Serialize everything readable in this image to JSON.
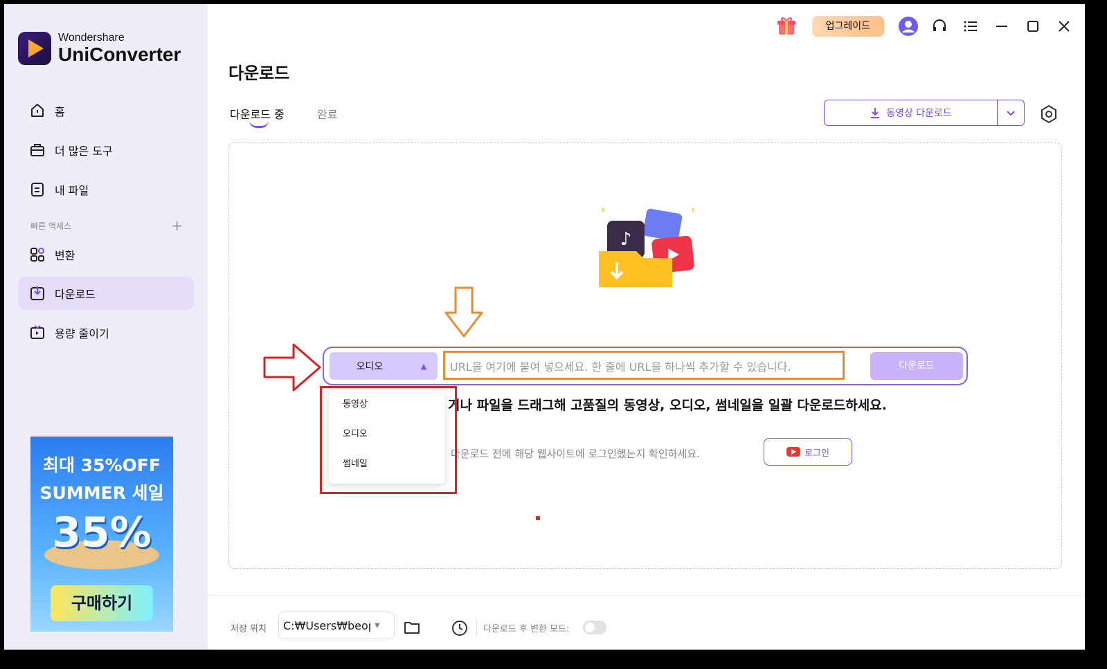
{
  "app": {
    "brand_small": "Wondershare",
    "brand_big": "UniConverter"
  },
  "sidebar": {
    "items": [
      {
        "label": "홈",
        "icon": "home-icon"
      },
      {
        "label": "더 많은 도구",
        "icon": "toolbox-icon"
      },
      {
        "label": "내 파일",
        "icon": "file-icon"
      }
    ],
    "quick_access_label": "빠른 액세스",
    "quick_items": [
      {
        "label": "변환",
        "icon": "convert-icon"
      },
      {
        "label": "다운로드",
        "icon": "download-icon",
        "active": true
      },
      {
        "label": "용량 줄이기",
        "icon": "compress-icon"
      }
    ],
    "promo": {
      "line1": "최대 35%OFF",
      "line2": "SUMMER 세일",
      "line3": "35%",
      "buy": "구매하기"
    }
  },
  "topbar": {
    "upgrade_label": "업그레이드"
  },
  "page": {
    "title": "다운로드",
    "tabs": [
      "다운로드 중",
      "완료"
    ],
    "video_download_label": "동영상 다운로드",
    "url_bar": {
      "type_selected": "오디오",
      "placeholder": "URL을 여기에 붙여 넣으세요. 한 줄에 URL을 하나씩 추가할 수 있습니다.",
      "download_label": "다운로드"
    },
    "dropdown_options": [
      "동영상",
      "오디오",
      "썸네일"
    ],
    "headline": "거나 파일을 드래그해 고품질의 동영상, 오디오, 썸네일을 일괄 다운로드하세요.",
    "notice": "다운로드 전에 해당 웹사이트에 로그인했는지 확인하세요.",
    "login_label": "로그인"
  },
  "bottom": {
    "save_location_label": "저장 위치",
    "save_path": "C:₩Users₩beop",
    "convert_after_label": "다운로드 후 변환 모드:"
  },
  "colors": {
    "accent": "#7a4dff",
    "annotation_red": "#e02020",
    "annotation_orange": "#ef8a2f"
  }
}
